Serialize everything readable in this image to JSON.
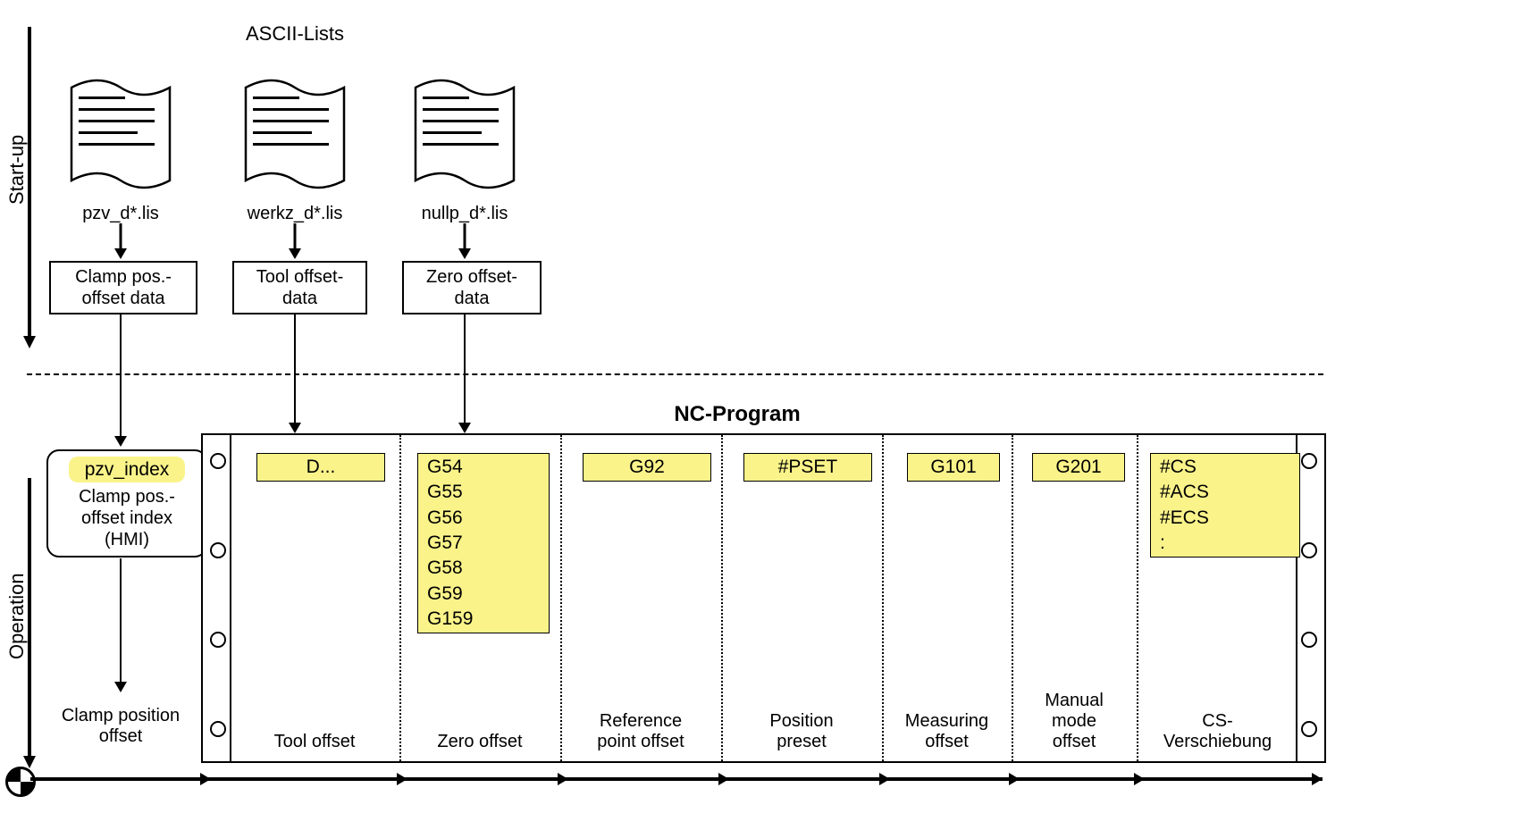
{
  "axes": {
    "startup": "Start-up",
    "operation": "Operation"
  },
  "header": {
    "ascii": "ASCII-Lists",
    "nc": "NC-Program"
  },
  "files": {
    "pzv": {
      "name": "pzv_d*.lis",
      "box": "Clamp pos.-\noffset data"
    },
    "tool": {
      "name": "werkz_d*.lis",
      "box": "Tool offset-\ndata"
    },
    "zero": {
      "name": "nullp_d*.lis",
      "box": "Zero offset-\ndata"
    }
  },
  "hmi": {
    "index": "pzv_index",
    "caption": "Clamp pos.-\noffset index\n(HMI)"
  },
  "columns": {
    "clamp": {
      "caption": "Clamp position\noffset"
    },
    "tool": {
      "code": "D...",
      "caption": "Tool offset"
    },
    "zero": {
      "codes": "G54\nG55\nG56\nG57\nG58\nG59\nG159",
      "caption": "Zero offset"
    },
    "ref": {
      "code": "G92",
      "caption": "Reference\npoint offset"
    },
    "pset": {
      "code": "#PSET",
      "caption": "Position\npreset"
    },
    "meas": {
      "code": "G101",
      "caption": "Measuring\noffset"
    },
    "man": {
      "code": "G201",
      "caption": "Manual\nmode\noffset"
    },
    "cs": {
      "codes": "#CS\n#ACS\n#ECS\n:",
      "caption": "CS-\nVerschiebung"
    }
  }
}
